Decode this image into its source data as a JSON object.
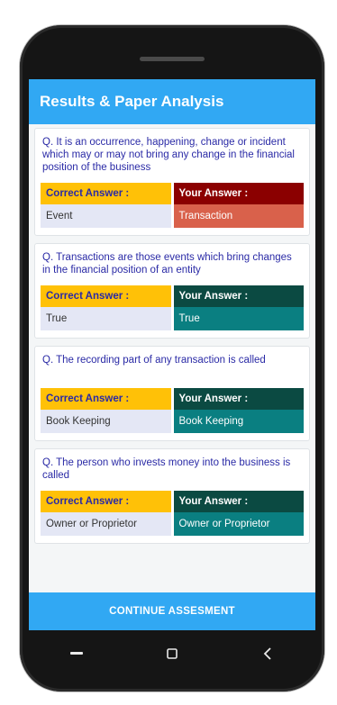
{
  "app": {
    "title": "Results & Paper Analysis"
  },
  "questions": [
    {
      "text": "Q. It is an occurrence, happening, change or incident which may or may not bring any change in the financial position of the business",
      "correct_label": "Correct Answer :",
      "correct_value": "Event",
      "your_label": "Your Answer :",
      "your_value": "Transaction",
      "status": "wrong"
    },
    {
      "text": "Q. Transactions are those events which bring changes in the financial position of an entity",
      "correct_label": "Correct Answer :",
      "correct_value": "True",
      "your_label": "Your Answer :",
      "your_value": "True",
      "status": "right"
    },
    {
      "text": "Q. The recording part of any transaction is called",
      "correct_label": "Correct Answer :",
      "correct_value": "Book Keeping",
      "your_label": "Your Answer :",
      "your_value": "Book Keeping",
      "status": "right"
    },
    {
      "text": "Q. The person who invests money into the business is called",
      "correct_label": "Correct Answer :",
      "correct_value": "Owner or Proprietor",
      "your_label": "Your Answer :",
      "your_value": "Owner or Proprietor",
      "status": "right"
    }
  ],
  "footer": {
    "continue_label": "CONTINUE ASSESMENT"
  },
  "colors": {
    "primary": "#31a8f3",
    "correct_header": "#ffc107",
    "wrong_header": "#8b0000",
    "wrong_value": "#d9614b",
    "right_header": "#0b4a42",
    "right_value": "#0a7f81"
  },
  "nav": {
    "icons": [
      "back-icon",
      "home-icon",
      "recents-icon"
    ]
  }
}
